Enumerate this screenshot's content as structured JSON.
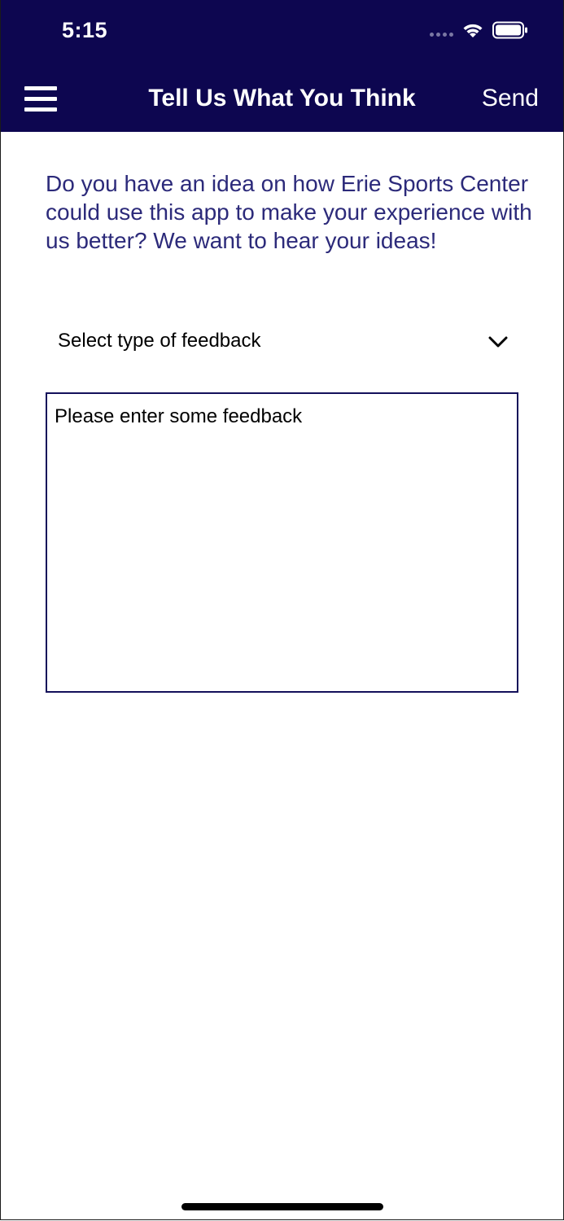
{
  "status_bar": {
    "time": "5:15",
    "icons": [
      "signal-dots-icon",
      "wifi-icon",
      "battery-icon"
    ]
  },
  "header": {
    "title": "Tell Us What You Think",
    "send_label": "Send",
    "menu_icon": "hamburger-menu-icon",
    "background_color": "#0d0650"
  },
  "main": {
    "intro_text": "Do you have an idea on how Erie Sports Center could use this app to make your experience with us better? We want to hear your ideas!",
    "feedback_type": {
      "selected_label": "Select type of feedback",
      "icon": "chevron-down-icon"
    },
    "feedback_input": {
      "placeholder": "Please enter some feedback",
      "value": ""
    }
  },
  "colors": {
    "accent": "#0d0650",
    "intro_text": "#2c2a7a",
    "input_border": "#13105a"
  }
}
